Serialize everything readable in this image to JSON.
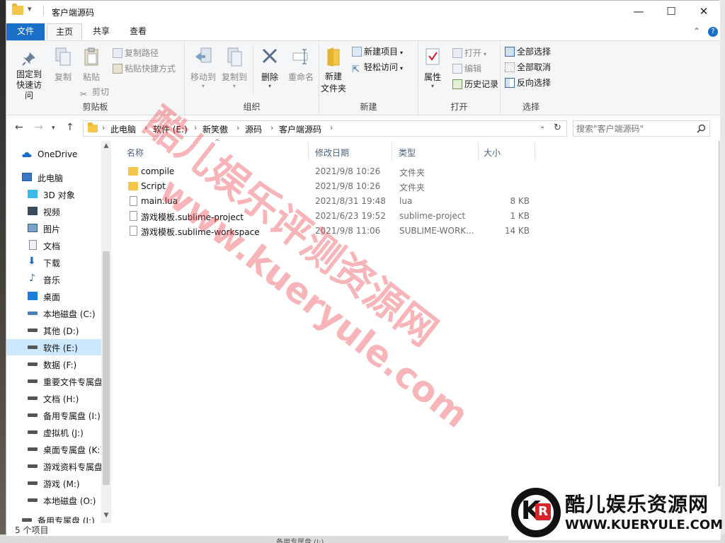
{
  "window": {
    "title": "客户端源码",
    "minimize": "—",
    "maximize": "☐",
    "close": "✕"
  },
  "ribbon_tabs": [
    {
      "label": "文件"
    },
    {
      "label": "主页"
    },
    {
      "label": "共享"
    },
    {
      "label": "查看"
    }
  ],
  "ribbon": {
    "clipboard": {
      "pin": "固定到快速访问",
      "copy": "复制",
      "paste": "粘贴",
      "copy_path": "复制路径",
      "paste_shortcut": "粘贴快捷方式",
      "cut": "剪切",
      "label": "剪贴板"
    },
    "organize": {
      "move_to": "移动到",
      "copy_to": "复制到",
      "delete": "删除",
      "rename": "重命名",
      "label": "组织"
    },
    "new": {
      "new_folder": "新建\n文件夹",
      "new_item": "新建项目",
      "easy_access": "轻松访问",
      "label": "新建"
    },
    "open": {
      "properties": "属性",
      "open": "打开",
      "edit": "编辑",
      "history": "历史记录",
      "label": "打开"
    },
    "select": {
      "select_all": "全部选择",
      "select_none": "全部取消",
      "invert": "反向选择",
      "label": "选择"
    }
  },
  "address": {
    "crumbs": [
      "此电脑",
      "软件 (E:)",
      "新笑傲",
      "源码",
      "客户端源码"
    ],
    "search_placeholder": "搜索\"客户端源码\""
  },
  "sidebar": {
    "items": [
      {
        "label": "OneDrive",
        "icon": "cloud-icon"
      },
      {
        "label": "此电脑",
        "icon": "computer-icon"
      },
      {
        "label": "3D 对象",
        "icon": "cube-icon"
      },
      {
        "label": "视频",
        "icon": "video-icon"
      },
      {
        "label": "图片",
        "icon": "picture-icon"
      },
      {
        "label": "文档",
        "icon": "document-icon"
      },
      {
        "label": "下载",
        "icon": "download-icon"
      },
      {
        "label": "音乐",
        "icon": "music-icon"
      },
      {
        "label": "桌面",
        "icon": "desktop-icon"
      },
      {
        "label": "本地磁盘 (C:)",
        "icon": "drive-icon"
      },
      {
        "label": "其他 (D:)",
        "icon": "drive-icon"
      },
      {
        "label": "软件 (E:)",
        "icon": "drive-icon"
      },
      {
        "label": "数据 (F:)",
        "icon": "drive-icon"
      },
      {
        "label": "重要文件专属盘",
        "icon": "drive-icon"
      },
      {
        "label": "文档 (H:)",
        "icon": "drive-icon"
      },
      {
        "label": "备用专属盘 (I:)",
        "icon": "drive-icon"
      },
      {
        "label": "虚拟机 (J:)",
        "icon": "drive-icon"
      },
      {
        "label": "桌面专属盘 (K:)",
        "icon": "drive-icon"
      },
      {
        "label": "游戏资料专属盘",
        "icon": "drive-icon"
      },
      {
        "label": "游戏 (M:)",
        "icon": "drive-icon"
      },
      {
        "label": "本地磁盘 (O:)",
        "icon": "drive-icon"
      },
      {
        "label": "备用专属盘 (I:)",
        "icon": "drive-icon"
      }
    ]
  },
  "columns": {
    "name": "名称",
    "date": "修改日期",
    "type": "类型",
    "size": "大小"
  },
  "files": [
    {
      "name": "compile",
      "date": "2021/9/8 10:26",
      "type": "文件夹",
      "size": "",
      "kind": "folder"
    },
    {
      "name": "Script",
      "date": "2021/9/8 10:26",
      "type": "文件夹",
      "size": "",
      "kind": "folder"
    },
    {
      "name": "main.lua",
      "date": "2021/8/31 19:48",
      "type": "lua",
      "size": "8 KB",
      "kind": "file"
    },
    {
      "name": "游戏模板.sublime-project",
      "date": "2021/6/23 19:52",
      "type": "sublime-project",
      "size": "1 KB",
      "kind": "file"
    },
    {
      "name": "游戏模板.sublime-workspace",
      "date": "2021/9/8 11:06",
      "type": "SUBLIME-WORK...",
      "size": "14 KB",
      "kind": "file"
    }
  ],
  "status": {
    "count": "5 个项目"
  },
  "watermark": {
    "line1": "酷儿娱乐评测资源网",
    "line2": "www.kueryule.com"
  },
  "logo": {
    "mark_k": "K",
    "mark_r": "R",
    "cn": "酷儿娱乐资源网",
    "en": "WWW.KUERYULE.COM"
  },
  "bottom_peek": "备用专属盘 (I:)",
  "colors": {
    "accent": "#1a6fc9",
    "folder": "#f3c84a",
    "selection": "#cce8ff",
    "watermark": "#eb3c46"
  }
}
